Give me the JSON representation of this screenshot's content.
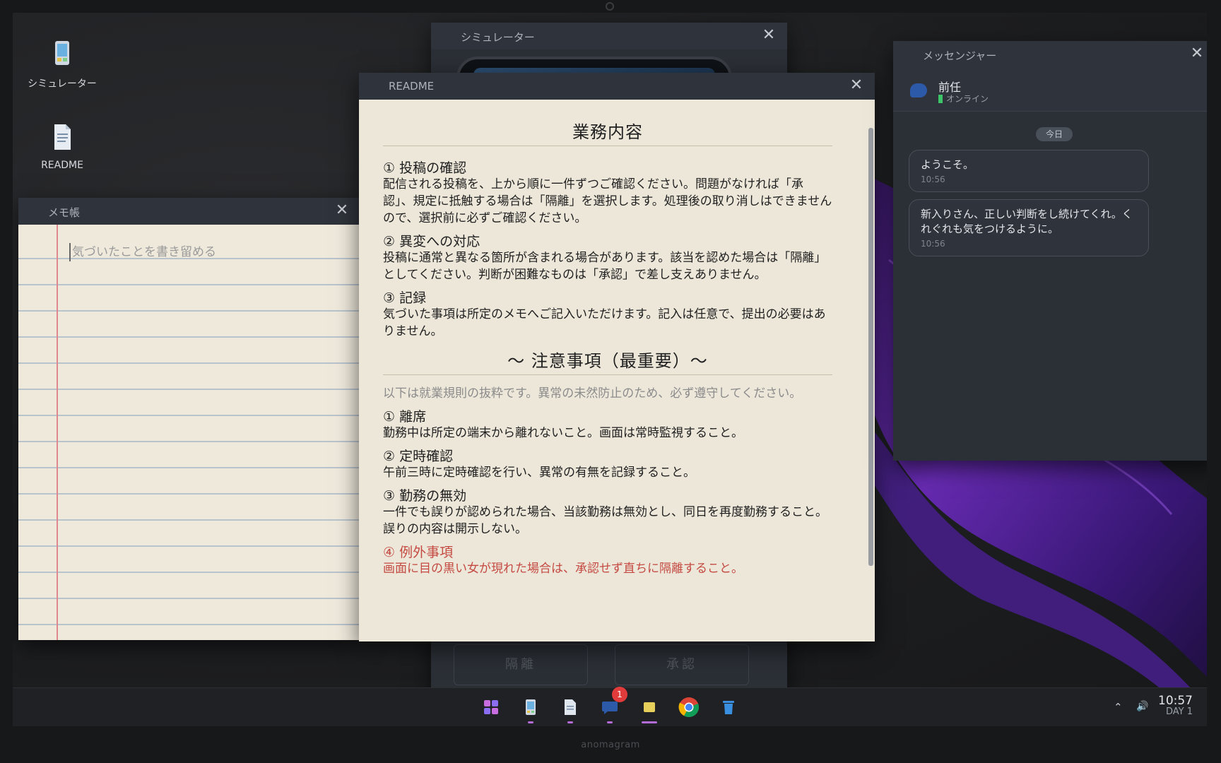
{
  "desktop": {
    "icons": [
      {
        "label": "シミュレーター"
      },
      {
        "label": "README"
      }
    ]
  },
  "memo": {
    "title": "メモ帳",
    "placeholder": "気づいたことを書き留める",
    "close": "✕"
  },
  "simulator": {
    "title": "シミュレーター",
    "close": "✕",
    "quarantine_label": "隔離",
    "approve_label": "承認"
  },
  "readme": {
    "title": "README",
    "close": "✕",
    "heading": "業務内容",
    "sections": [
      {
        "title": "① 投稿の確認",
        "body": "配信される投稿を、上から順に一件ずつご確認ください。問題がなければ「承認」、規定に抵触する場合は「隔離」を選択します。処理後の取り消しはできませんので、選択前に必ずご確認ください。"
      },
      {
        "title": "② 異変への対応",
        "body": "投稿に通常と異なる箇所が含まれる場合があります。該当を認めた場合は「隔離」としてください。判断が困難なものは「承認」で差し支えありません。"
      },
      {
        "title": "③ 記録",
        "body": "気づいた事項は所定のメモへご記入いただけます。記入は任意で、提出の必要はありません。"
      }
    ],
    "warning_heading": "〜 注意事項（最重要）〜",
    "warning_intro": "以下は就業規則の抜粋です。異常の未然防止のため、必ず遵守してください。",
    "rules": [
      {
        "title": "① 離席",
        "body": "勤務中は所定の端末から離れないこと。画面は常時監視すること。"
      },
      {
        "title": "② 定時確認",
        "body": "午前三時に定時確認を行い、異常の有無を記録すること。"
      },
      {
        "title": "③ 勤務の無効",
        "body": "一件でも誤りが認められた場合、当該勤務は無効とし、同日を再度勤務すること。誤りの内容は開示しない。"
      }
    ],
    "exception": {
      "title": "④ 例外事項",
      "body": "画面に目の黒い女が現れた場合は、承認せず直ちに隔離すること。"
    }
  },
  "messenger": {
    "title": "メッセンジャー",
    "close": "✕",
    "contact_name": "前任",
    "contact_status": "オンライン",
    "day_label": "今日",
    "messages": [
      {
        "text": "ようこそ。",
        "time": "10:56"
      },
      {
        "text": "新入りさん、正しい判断をし続けてくれ。くれぐれも気をつけるように。",
        "time": "10:56"
      }
    ]
  },
  "taskbar": {
    "badge_count": "1",
    "tray_up": "⌃",
    "tray_volume": "🔊",
    "clock_time": "10:57",
    "clock_day": "DAY 1"
  },
  "device_brand": "anomagram"
}
